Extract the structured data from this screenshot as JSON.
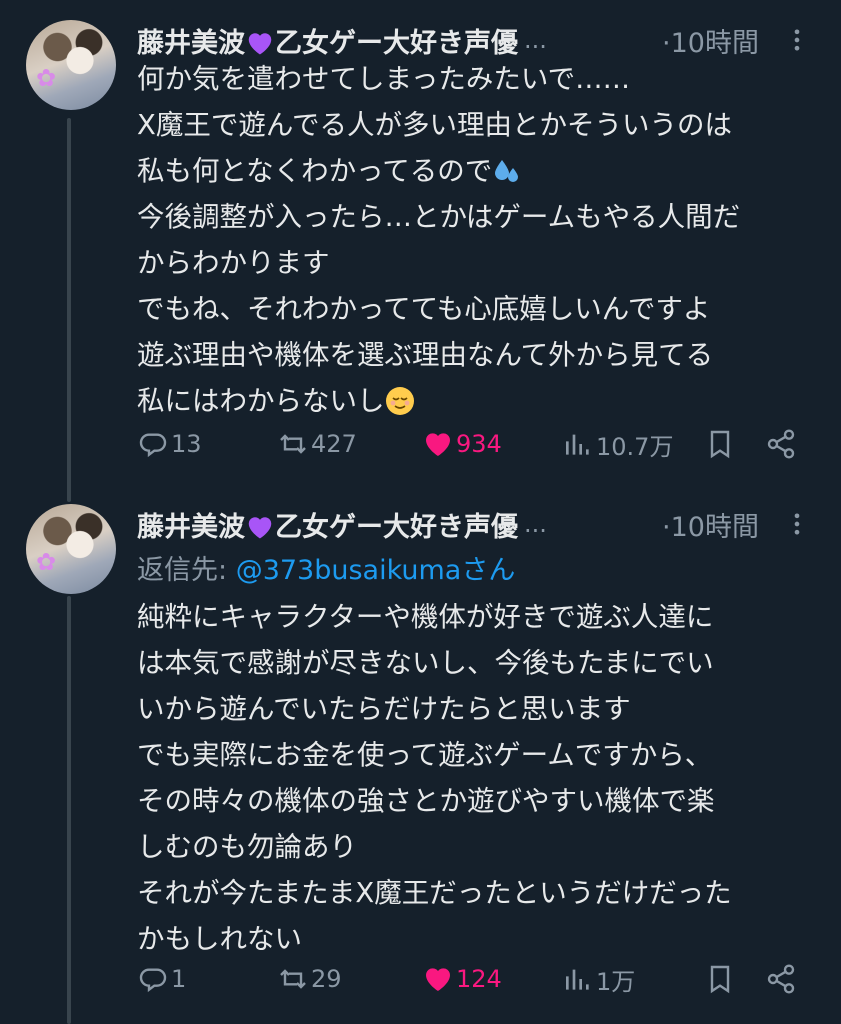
{
  "tweets": [
    {
      "author": "藤井美波",
      "author_suffix": "乙女ゲー大好き声優",
      "ellipsis": "...",
      "time": "·10時間",
      "reply_to": null,
      "lines": [
        "何か気を遣わせてしまったみたいで……",
        "X魔王で遊んでる人が多い理由とかそういうのは",
        "私も何となくわかってるので",
        "今後調整が入ったら…とかはゲームもやる人間だ",
        "からわかります",
        "でもね、それわかってても心底嬉しいんですよ",
        "遊ぶ理由や機体を選ぶ理由なんて外から見てる",
        "私にはわからないし"
      ],
      "actions": {
        "replies": "13",
        "retweets": "427",
        "likes": "934",
        "views": "10.7万"
      }
    },
    {
      "author": "藤井美波",
      "author_suffix": "乙女ゲー大好き声優",
      "ellipsis": "...",
      "time": "·10時間",
      "reply_to": {
        "prefix": "返信先: ",
        "handle": "@373busaikumaさん"
      },
      "lines": [
        "純粋にキャラクターや機体が好きで遊ぶ人達に",
        "は本気で感謝が尽きないし、今後もたまにでい",
        "いから遊んでいたらだけたらと思います",
        "でも実際にお金を使って遊ぶゲームですから、",
        "その時々の機体の強さとか遊びやすい機体で楽",
        "しむのも勿論あり",
        "それが今たまたまX魔王だったというだけだった",
        "かもしれない"
      ],
      "actions": {
        "replies": "1",
        "retweets": "29",
        "likes": "124",
        "views": "1万"
      }
    }
  ],
  "icons": {
    "name_heart": "purple-heart-icon",
    "sweat": "sweat-droplets-icon",
    "relieved": "relieved-face-icon"
  },
  "colors": {
    "background": "#15202b",
    "text": "#e7e9ea",
    "muted": "#8b98a5",
    "link": "#1d9bf0",
    "like": "#f91880",
    "purple_heart": "#a855f7"
  }
}
